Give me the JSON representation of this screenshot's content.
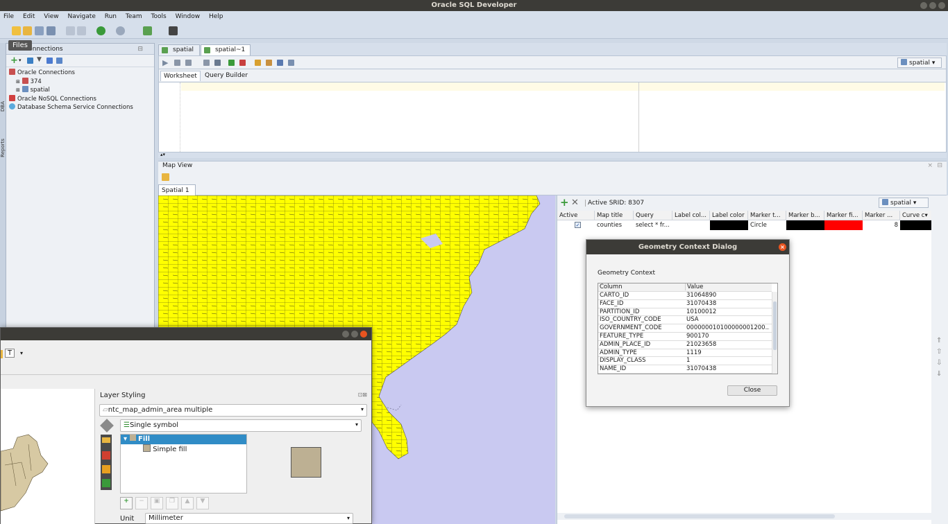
{
  "window": {
    "title": "Oracle SQL Developer"
  },
  "menu": [
    "File",
    "Edit",
    "View",
    "Navigate",
    "Run",
    "Team",
    "Tools",
    "Window",
    "Help"
  ],
  "tooltip": "Files",
  "sidebar_vertical_tabs": [
    "DBA",
    "Reports"
  ],
  "connections": {
    "header": "Connections",
    "tree": [
      "Oracle Connections",
      "374",
      "spatial",
      "Oracle NoSQL Connections",
      "Database Schema Service Connections"
    ]
  },
  "editor": {
    "tabs": [
      "spatial",
      "spatial~1"
    ],
    "connection_selector": "spatial",
    "worksheet_tabs": [
      "Worksheet",
      "Query Builder"
    ]
  },
  "map_view": {
    "title": "Map View",
    "tab": "Spatial 1",
    "active_srid": "Active SRID: 8307",
    "connection": "spatial",
    "columns": [
      "Active",
      "Map title",
      "Query",
      "Label col...",
      "Label color",
      "Marker t...",
      "Marker b...",
      "Marker fi...",
      "Marker ...",
      "Curve c"
    ],
    "row": {
      "map_title": "counties",
      "query": "select * fr...",
      "marker_type": "Circle",
      "marker_size": "8"
    }
  },
  "geometry_dialog": {
    "title": "Geometry Context Dialog",
    "label": "Geometry Context",
    "columns": [
      "Column",
      "Value"
    ],
    "rows": [
      [
        "CARTO_ID",
        "31064890"
      ],
      [
        "FACE_ID",
        "31070438"
      ],
      [
        "PARTITION_ID",
        "10100012"
      ],
      [
        "ISO_COUNTRY_CODE",
        "USA"
      ],
      [
        "GOVERNMENT_CODE",
        "000000010100000001200..."
      ],
      [
        "FEATURE_TYPE",
        "900170"
      ],
      [
        "ADMIN_PLACE_ID",
        "21023658"
      ],
      [
        "ADMIN_TYPE",
        "1119"
      ],
      [
        "DISPLAY_CLASS",
        "1"
      ],
      [
        "NAME_ID",
        "31070438"
      ]
    ],
    "close_label": "Close"
  },
  "qgis": {
    "panel_title": "Layer Styling",
    "layer": "ntc_map_admin_area multiple",
    "renderer": "Single symbol",
    "symbol_tree": [
      "Fill",
      "Simple fill"
    ],
    "unit_label": "Unit",
    "unit_value": "Millimeter",
    "text_tool": "T"
  },
  "colors": {
    "map_fill": "#ffff00",
    "map_bg": "#c9c9f1",
    "label_color": "#000000",
    "marker_fill": "#ff0000",
    "symbol_fill": "#bdb093",
    "tree_selected": "#308cc6"
  }
}
